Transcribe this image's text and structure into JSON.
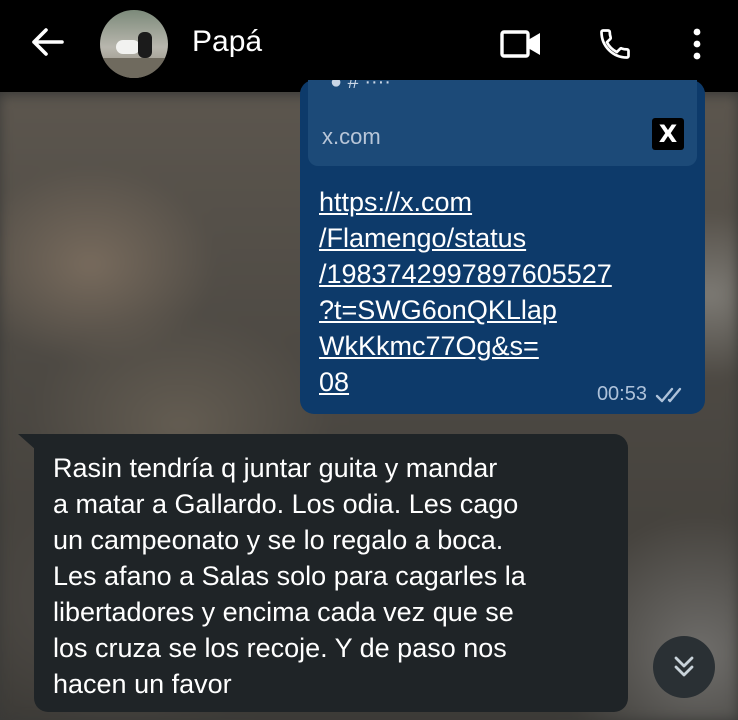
{
  "header": {
    "contact_name": "Papá",
    "back_icon": "arrow-left-icon",
    "video_icon": "video-camera-icon",
    "call_icon": "phone-icon",
    "menu_icon": "more-vertical-icon"
  },
  "messages": {
    "outgoing": {
      "preview_domain": "x.com",
      "preview_logo": "X",
      "link_lines": [
        "https://x.com",
        "/Flamengo/status",
        "/1983742997897605527",
        "?t=SWG6onQKLlap",
        "WkKkmc77Og&s=",
        "08"
      ],
      "time": "00:53",
      "status_icon": "double-check-icon"
    },
    "incoming": {
      "lines": [
        "Rasin tendría q juntar guita y mandar",
        "a matar a Gallardo. Los odia. Les cago",
        "un campeonato y se lo regalo a boca.",
        "Les afano a Salas solo para cagarles la",
        "libertadores y encima cada vez que se",
        "los cruza se los recoje. Y de paso nos",
        "hacen un favor"
      ]
    }
  },
  "colors": {
    "header_bg": "#000000",
    "outgoing_bubble": "#0d3a6a",
    "incoming_bubble": "#1f2427"
  }
}
